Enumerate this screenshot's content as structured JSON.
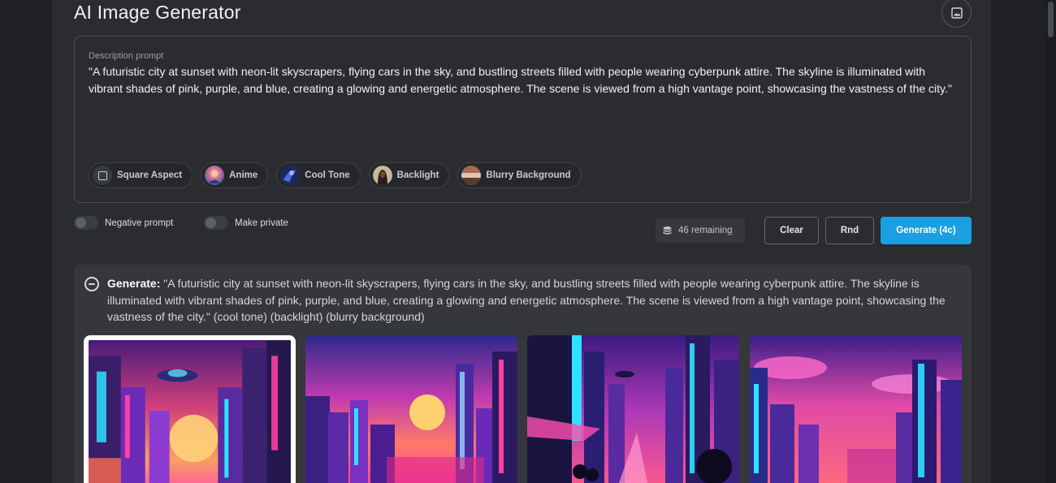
{
  "app": {
    "title": "AI Image Generator"
  },
  "prompt": {
    "label": "Description prompt",
    "text": "\"A futuristic city at sunset with neon-lit skyscrapers, flying cars in the sky, and bustling streets filled with people wearing cyberpunk attire. The skyline is illuminated with vibrant shades of pink, purple, and blue, creating a glowing and energetic atmosphere. The scene is viewed from a high vantage point, showcasing the vastness of the city.\""
  },
  "chips": [
    {
      "label": "Square Aspect",
      "icon": "square-icon"
    },
    {
      "label": "Anime",
      "icon": "anime-thumb"
    },
    {
      "label": "Cool Tone",
      "icon": "cool-tone-thumb"
    },
    {
      "label": "Backlight",
      "icon": "backlight-thumb"
    },
    {
      "label": "Blurry Background",
      "icon": "blurry-thumb"
    }
  ],
  "options": {
    "negative_prompt": {
      "label": "Negative prompt",
      "on": false
    },
    "make_private": {
      "label": "Make private",
      "on": false
    }
  },
  "credits": {
    "remaining_text": "46 remaining",
    "icon": "coins-stack-icon"
  },
  "buttons": {
    "clear": "Clear",
    "random": "Rnd",
    "generate": "Generate (4c)"
  },
  "result": {
    "heading": "Generate:",
    "text": " \"A futuristic city at sunset with neon-lit skyscrapers, flying cars in the sky, and bustling streets filled with people wearing cyberpunk attire. The skyline is illuminated with vibrant shades of pink, purple, and blue, creating a glowing and energetic atmosphere. The scene is viewed from a high vantage point, showcasing the vastness of the city.\" (cool tone) (backlight) (blurry background)"
  },
  "images": [
    {
      "name": "generated-image-1",
      "selected": true
    },
    {
      "name": "generated-image-2",
      "selected": false
    },
    {
      "name": "generated-image-3",
      "selected": false
    },
    {
      "name": "generated-image-4",
      "selected": false
    }
  ],
  "colors": {
    "background": "#1f2124",
    "panel": "#2a2c30",
    "accent": "#1b9fe0",
    "neon_pink": "#ff3fa4",
    "neon_cyan": "#2de2ff",
    "sky_purple": "#6a2bb8"
  }
}
